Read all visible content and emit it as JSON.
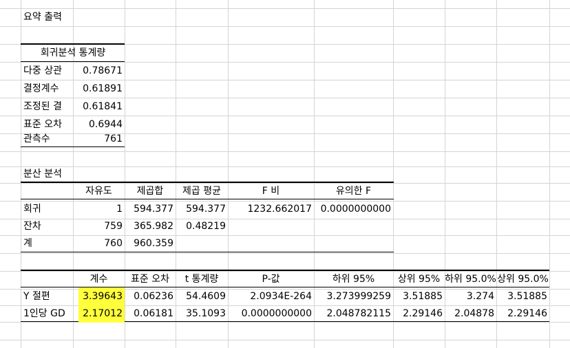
{
  "title": "요약 출력",
  "regression_stats": {
    "header": "회귀분석 통계량",
    "rows": [
      {
        "label": "다중 상관",
        "value": "0.78671"
      },
      {
        "label": "결정계수",
        "value": "0.61891"
      },
      {
        "label": "조정된 결",
        "value": "0.61841"
      },
      {
        "label": "표준 오차",
        "value": "0.6944"
      },
      {
        "label": "관측수",
        "value": "761"
      }
    ]
  },
  "anova": {
    "title": "분산 분석",
    "headers": [
      "자유도",
      "제곱합",
      "제곱 평균",
      "F 비",
      "유의한 F"
    ],
    "rows": [
      {
        "label": "회귀",
        "values": [
          "1",
          "594.377",
          "594.377",
          "1232.662017",
          "0.0000000000"
        ]
      },
      {
        "label": "잔차",
        "values": [
          "759",
          "365.982",
          "0.48219",
          "",
          ""
        ]
      },
      {
        "label": "계",
        "values": [
          "760",
          "960.359",
          "",
          "",
          ""
        ]
      }
    ]
  },
  "coefficients": {
    "headers": [
      "계수",
      "표준 오차",
      "t 통계량",
      "P-값",
      "하위 95%",
      "상위 95%",
      "하위 95.0%",
      "상위 95.0%"
    ],
    "rows": [
      {
        "label": "Y 절편",
        "values": [
          "3.39643",
          "0.06236",
          "54.4609",
          "2.0934E-264",
          "3.273999259",
          "3.51885",
          "3.274",
          "3.51885"
        ]
      },
      {
        "label": "1인당 GD",
        "values": [
          "2.17012",
          "0.06181",
          "35.1093",
          "0.0000000000",
          "2.048782115",
          "2.29146",
          "2.04878",
          "2.29146"
        ]
      }
    ]
  },
  "colors": {
    "highlight": "#ffff3c",
    "gridline": "#d4d4d4"
  }
}
